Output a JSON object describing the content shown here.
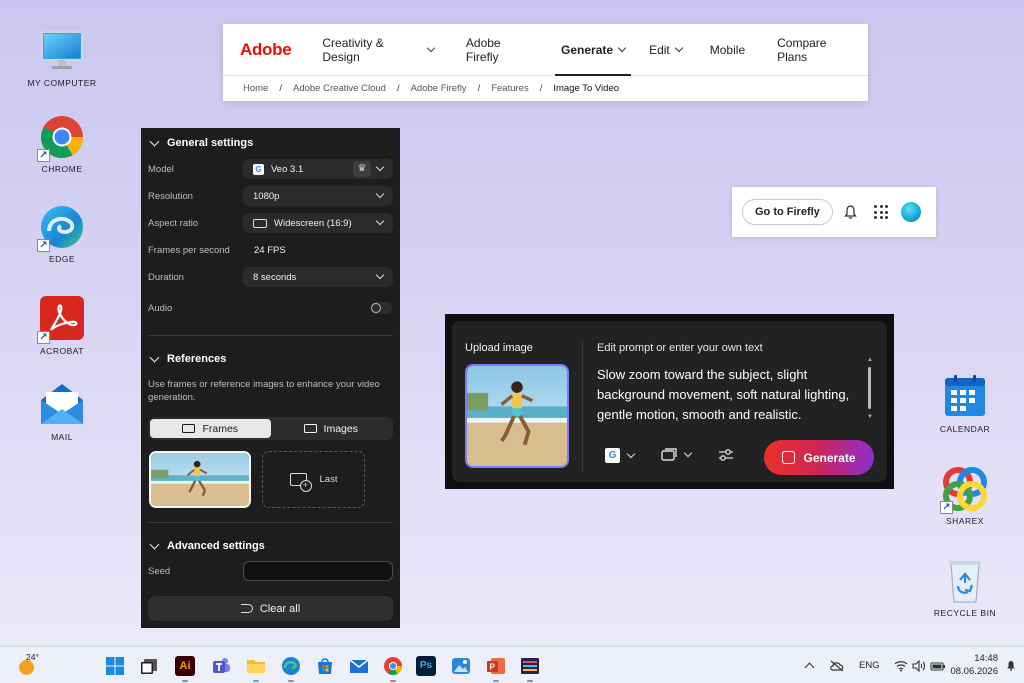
{
  "desktop": {
    "icons_left": [
      {
        "label": "MY COMPUTER",
        "icon": "monitor-icon"
      },
      {
        "label": "CHROME",
        "icon": "chrome-icon"
      },
      {
        "label": "EDGE",
        "icon": "edge-icon"
      },
      {
        "label": "ACROBAT",
        "icon": "acrobat-icon"
      },
      {
        "label": "MAIL",
        "icon": "mail-icon"
      }
    ],
    "icons_right": [
      {
        "label": "CALENDAR",
        "icon": "calendar-icon"
      },
      {
        "label": "SHAREX",
        "icon": "sharex-icon"
      },
      {
        "label": "RECYCLE BIN",
        "icon": "recycle-bin-icon"
      }
    ]
  },
  "adobe_nav": {
    "logo": "Adobe",
    "items": [
      {
        "label": "Creativity & Design",
        "dropdown": true
      },
      {
        "label": "Adobe Firefly",
        "dropdown": false
      },
      {
        "label": "Generate",
        "dropdown": true,
        "active": true
      },
      {
        "label": "Edit",
        "dropdown": true
      },
      {
        "label": "Mobile",
        "dropdown": false
      },
      {
        "label": "Compare Plans",
        "dropdown": false
      }
    ],
    "breadcrumb": [
      "Home",
      "Adobe Creative Cloud",
      "Adobe Firefly",
      "Features",
      "Image To Video"
    ],
    "breadcrumb_sep": "/"
  },
  "settings": {
    "general_title": "General settings",
    "model": {
      "label": "Model",
      "value": "Veo 3.1"
    },
    "resolution": {
      "label": "Resolution",
      "value": "1080p"
    },
    "aspect_ratio": {
      "label": "Aspect ratio",
      "value": "Widescreen (16:9)"
    },
    "fps": {
      "label": "Frames per second",
      "value": "24 FPS"
    },
    "duration": {
      "label": "Duration",
      "value": "8 seconds"
    },
    "audio": {
      "label": "Audio",
      "enabled": false
    },
    "references_title": "References",
    "references_desc": "Use frames or reference images to enhance your video generation.",
    "tabs": [
      {
        "label": "Frames",
        "selected": true
      },
      {
        "label": "Images",
        "selected": false
      }
    ],
    "last_slot": "Last",
    "advanced_title": "Advanced settings",
    "seed": {
      "label": "Seed",
      "value": ""
    },
    "clear_all": "Clear all"
  },
  "firefly_bar": {
    "go_button": "Go to Firefly"
  },
  "prompt_card": {
    "upload_title": "Upload image",
    "edit_title": "Edit prompt or enter your own text",
    "prompt_text": "Slow zoom toward the subject, slight background movement, soft natural lighting, gentle motion, smooth and realistic.",
    "generate_label": "Generate",
    "generate_colors": [
      "#e8312c",
      "#8c2fd1"
    ]
  },
  "taskbar": {
    "weather_temp": "24°",
    "language": "ENG",
    "time": "14:48",
    "date": "08.06.2026"
  }
}
